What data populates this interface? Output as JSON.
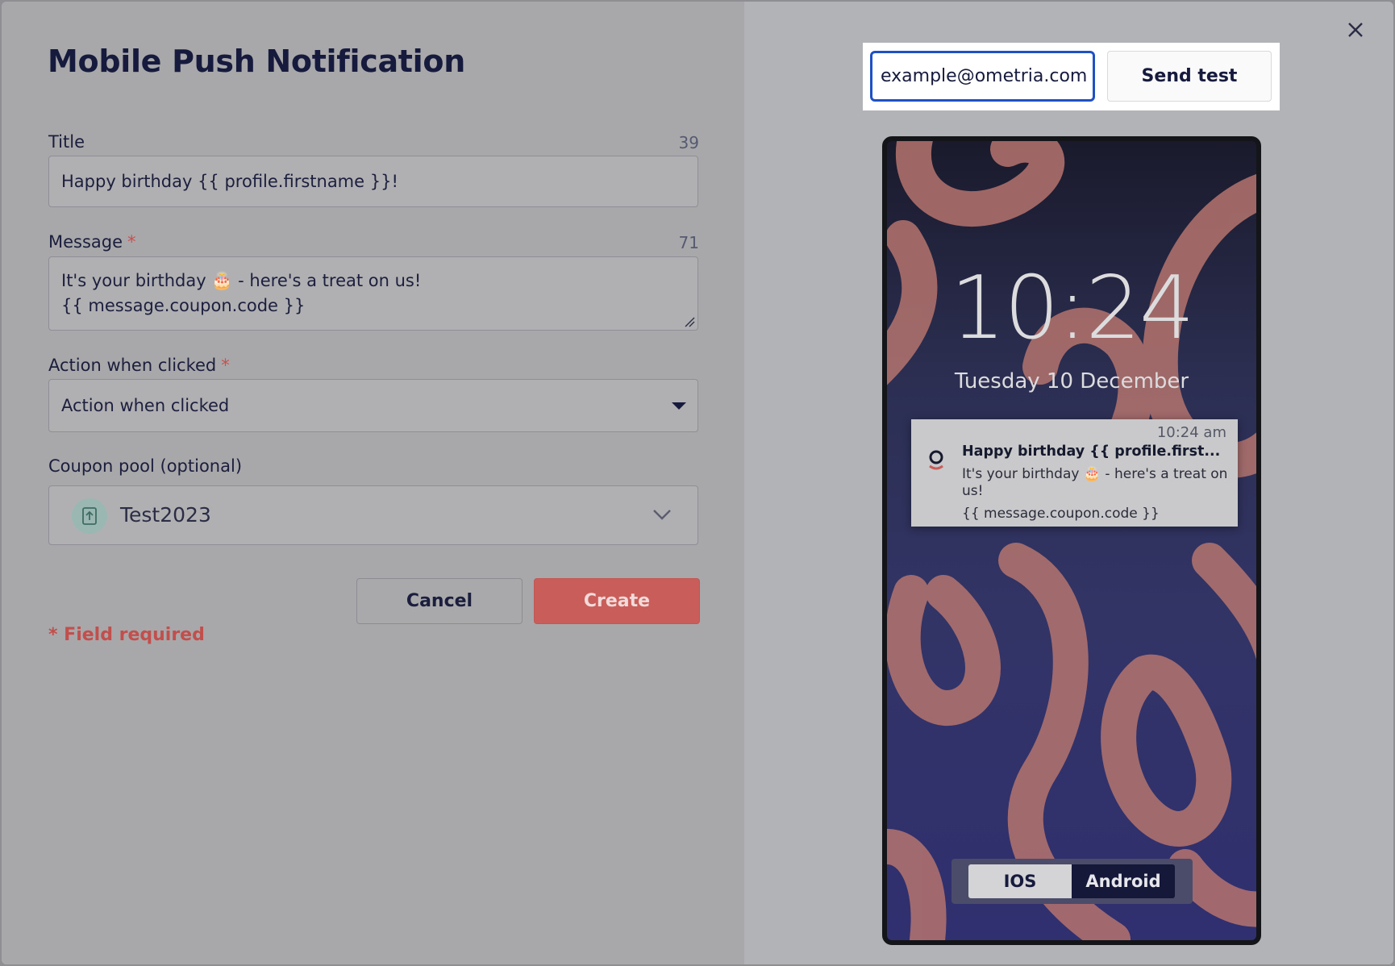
{
  "modal": {
    "title": "Mobile Push Notification",
    "close_icon": "close-icon"
  },
  "form": {
    "title": {
      "label": "Title",
      "char_count": "39",
      "value": "Happy birthday {{ profile.firstname }}!"
    },
    "message": {
      "label": "Message",
      "required_mark": "*",
      "char_count": "71",
      "line1": "It's your birthday 🎂 - here's a treat on us!",
      "line2": "{{ message.coupon.code }}"
    },
    "action": {
      "label": "Action when clicked",
      "required_mark": "*",
      "placeholder": "Action when clicked"
    },
    "coupon": {
      "label": "Coupon pool (optional)",
      "value": "Test2023",
      "icon": "coupon-upload-icon"
    },
    "buttons": {
      "cancel": "Cancel",
      "create": "Create"
    },
    "required_note": "* Field required"
  },
  "test_send": {
    "email_value": "example@ometria.com",
    "send_label": "Send test"
  },
  "preview": {
    "clock": "10:24",
    "date": "Tuesday 10 December",
    "notification": {
      "time": "10:24 am",
      "title": "Happy birthday {{ profile.first...",
      "body": "It's your birthday 🎂 - here's a treat on us!",
      "code": "{{ message.coupon.code }}"
    },
    "platform_toggle": {
      "ios": "IOS",
      "android": "Android",
      "selected": "Android"
    }
  },
  "colors": {
    "accent_red": "#c95d59",
    "focus_blue": "#1f51c4",
    "navy": "#161a3d"
  }
}
